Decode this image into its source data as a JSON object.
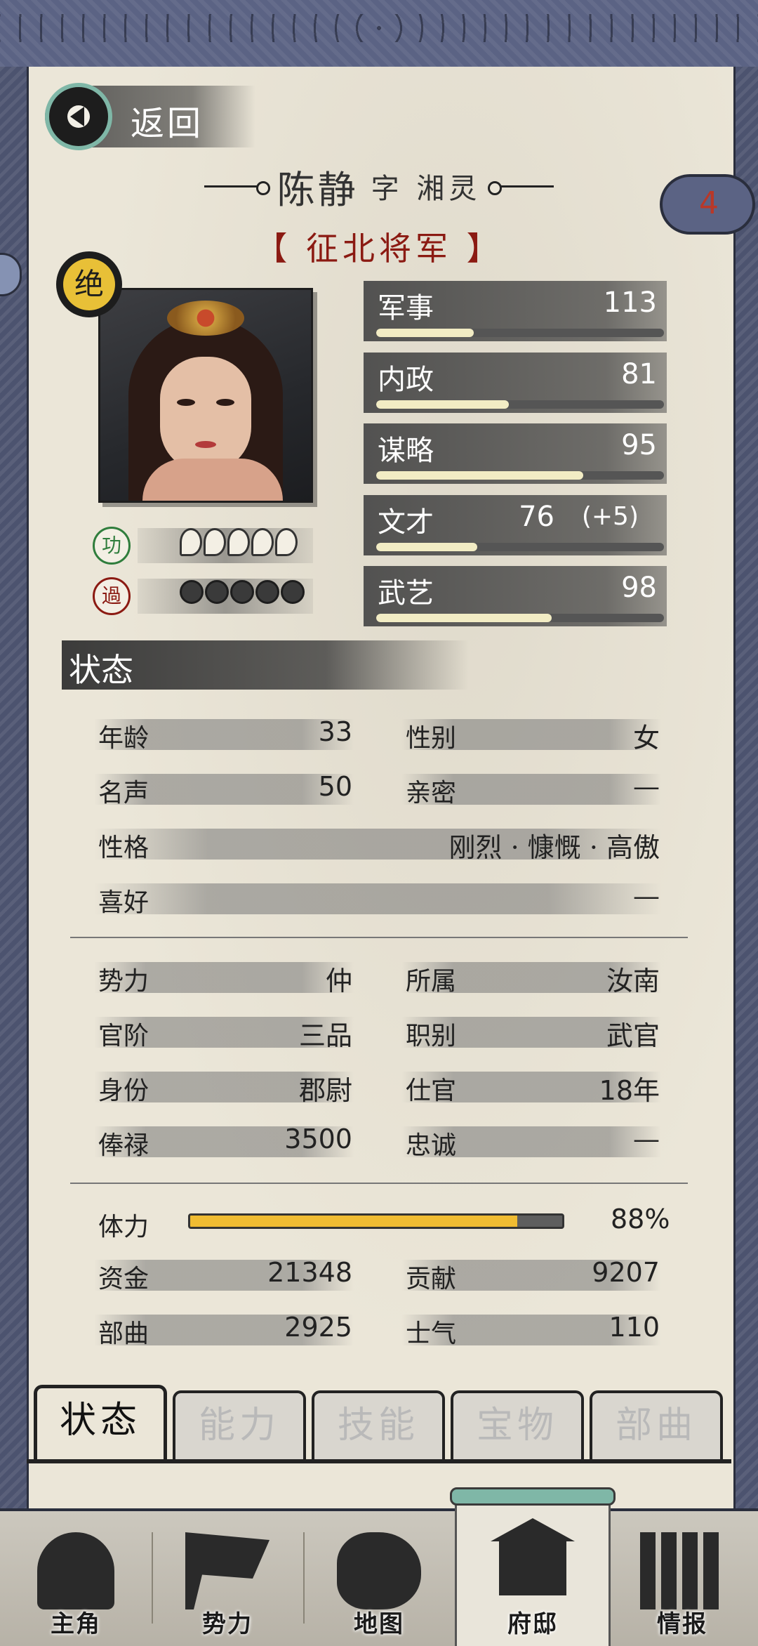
{
  "back": {
    "label": "返回"
  },
  "header": {
    "name": "陈静",
    "courtesy": "字 湘灵",
    "title": "【 征北将军 】",
    "badge": "绝",
    "cloud_count": "4"
  },
  "merit": {
    "seal": "功",
    "pips": 5
  },
  "demerit": {
    "seal": "過",
    "pips": 5
  },
  "attributes": [
    {
      "name": "军事",
      "value": "113",
      "bonus": "",
      "fill": 0.34
    },
    {
      "name": "内政",
      "value": "81",
      "bonus": "",
      "fill": 0.46
    },
    {
      "name": "谋略",
      "value": "95",
      "bonus": "",
      "fill": 0.72
    },
    {
      "name": "文才",
      "value": "76",
      "bonus": "(+5)",
      "fill": 0.35
    },
    {
      "name": "武艺",
      "value": "98",
      "bonus": "",
      "fill": 0.61
    }
  ],
  "status": {
    "heading": "状态",
    "personal": [
      {
        "key": "年龄",
        "value": "33"
      },
      {
        "key": "性别",
        "value": "女"
      },
      {
        "key": "名声",
        "value": "50"
      },
      {
        "key": "亲密",
        "value": "—"
      },
      {
        "key": "性格",
        "value": "刚烈 · 慷慨 · 高傲"
      },
      {
        "key": "喜好",
        "value": "—"
      }
    ],
    "official": [
      {
        "key": "势力",
        "value": "仲"
      },
      {
        "key": "所属",
        "value": "汝南"
      },
      {
        "key": "官阶",
        "value": "三品"
      },
      {
        "key": "职别",
        "value": "武官"
      },
      {
        "key": "身份",
        "value": "郡尉"
      },
      {
        "key": "仕官",
        "value": "18年"
      },
      {
        "key": "俸禄",
        "value": "3500"
      },
      {
        "key": "忠诚",
        "value": "—"
      }
    ],
    "stamina": {
      "label": "体力",
      "value": "88%",
      "fill": 0.88
    },
    "resources": [
      {
        "key": "资金",
        "value": "21348"
      },
      {
        "key": "贡献",
        "value": "9207"
      },
      {
        "key": "部曲",
        "value": "2925"
      },
      {
        "key": "士气",
        "value": "110"
      }
    ]
  },
  "tabs": [
    "状态",
    "能力",
    "技能",
    "宝物",
    "部曲"
  ],
  "active_tab": 0,
  "nav": [
    {
      "label": "主角",
      "icon": "hero-icon"
    },
    {
      "label": "势力",
      "icon": "flag-icon"
    },
    {
      "label": "地图",
      "icon": "map-icon"
    },
    {
      "label": "府邸",
      "icon": "mansion-icon"
    },
    {
      "label": "情报",
      "icon": "scrolls-icon"
    }
  ],
  "active_nav": 3,
  "colors": {
    "title_red": "#8b1a12",
    "stamina": "#f0bc32",
    "accent_teal": "#7fb7a7",
    "badge_gold": "#e8c037"
  }
}
